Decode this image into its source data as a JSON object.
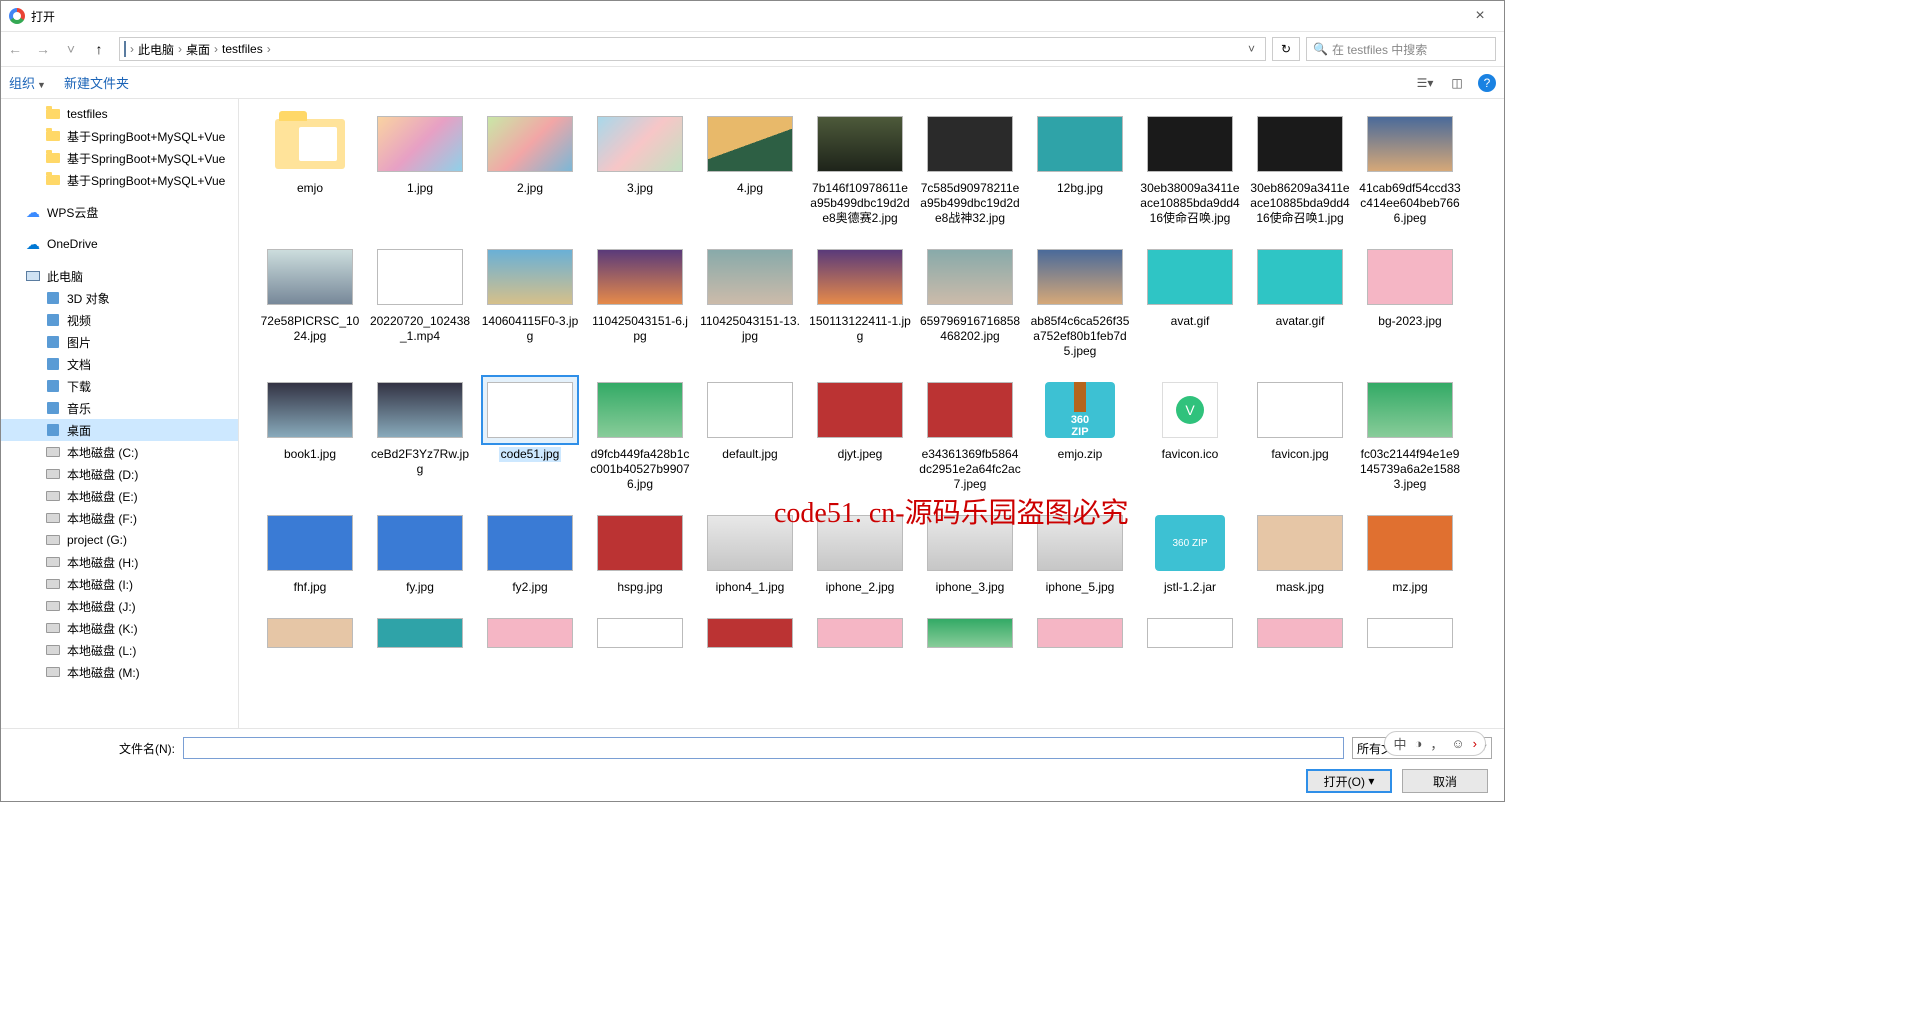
{
  "window": {
    "title": "打开"
  },
  "breadcrumb": {
    "items": [
      "此电脑",
      "桌面",
      "testfiles"
    ],
    "sep": "›"
  },
  "search": {
    "placeholder": "在 testfiles 中搜索"
  },
  "toolbar": {
    "organize": "组织",
    "newfolder": "新建文件夹"
  },
  "watermark": "code51. cn-源码乐园盗图必究",
  "sidebar": [
    {
      "label": "testfiles",
      "icon": "folder",
      "lvl": 1
    },
    {
      "label": "基于SpringBoot+MySQL+Vue",
      "icon": "folder",
      "lvl": 1
    },
    {
      "label": "基于SpringBoot+MySQL+Vue",
      "icon": "folder",
      "lvl": 1
    },
    {
      "label": "基于SpringBoot+MySQL+Vue",
      "icon": "folder",
      "lvl": 1
    },
    {
      "label": "WPS云盘",
      "icon": "wps",
      "lvl": 0,
      "gap": true
    },
    {
      "label": "OneDrive",
      "icon": "onedrive",
      "lvl": 0,
      "gap": true
    },
    {
      "label": "此电脑",
      "icon": "pc",
      "lvl": 0,
      "gap": true
    },
    {
      "label": "3D 对象",
      "icon": "lib",
      "lvl": 1
    },
    {
      "label": "视频",
      "icon": "lib",
      "lvl": 1
    },
    {
      "label": "图片",
      "icon": "lib",
      "lvl": 1
    },
    {
      "label": "文档",
      "icon": "lib",
      "lvl": 1
    },
    {
      "label": "下载",
      "icon": "lib",
      "lvl": 1
    },
    {
      "label": "音乐",
      "icon": "lib",
      "lvl": 1
    },
    {
      "label": "桌面",
      "icon": "lib",
      "lvl": 1,
      "sel": true
    },
    {
      "label": "本地磁盘 (C:)",
      "icon": "drive",
      "lvl": 1
    },
    {
      "label": "本地磁盘 (D:)",
      "icon": "drive",
      "lvl": 1
    },
    {
      "label": "本地磁盘 (E:)",
      "icon": "drive",
      "lvl": 1
    },
    {
      "label": "本地磁盘 (F:)",
      "icon": "drive",
      "lvl": 1
    },
    {
      "label": "project (G:)",
      "icon": "drive",
      "lvl": 1
    },
    {
      "label": "本地磁盘 (H:)",
      "icon": "drive",
      "lvl": 1
    },
    {
      "label": "本地磁盘 (I:)",
      "icon": "drive",
      "lvl": 1
    },
    {
      "label": "本地磁盘 (J:)",
      "icon": "drive",
      "lvl": 1
    },
    {
      "label": "本地磁盘 (K:)",
      "icon": "drive",
      "lvl": 1
    },
    {
      "label": "本地磁盘 (L:)",
      "icon": "drive",
      "lvl": 1
    },
    {
      "label": "本地磁盘 (M:)",
      "icon": "drive",
      "lvl": 1
    }
  ],
  "files": [
    {
      "name": "emjo",
      "type": "folder"
    },
    {
      "name": "1.jpg",
      "type": "img",
      "cls": "g1"
    },
    {
      "name": "2.jpg",
      "type": "img",
      "cls": "g2"
    },
    {
      "name": "3.jpg",
      "type": "img",
      "cls": "g3"
    },
    {
      "name": "4.jpg",
      "type": "img",
      "cls": "g4"
    },
    {
      "name": "7b146f10978611ea95b499dbc19d2de8奥德赛2.jpg",
      "type": "img",
      "cls": "game1"
    },
    {
      "name": "7c585d90978211ea95b499dbc19d2de8战神32.jpg",
      "type": "img",
      "cls": "dark"
    },
    {
      "name": "12bg.jpg",
      "type": "img",
      "cls": "teal"
    },
    {
      "name": "30eb38009a3411eace10885bda9dd416使命召唤.jpg",
      "type": "img",
      "cls": "game2"
    },
    {
      "name": "30eb86209a3411eace10885bda9dd416使命召唤1.jpg",
      "type": "img",
      "cls": "game2"
    },
    {
      "name": "41cab69df54ccd33c414ee604beb7666.jpeg",
      "type": "img",
      "cls": "sky"
    },
    {
      "name": "72e58PICRSC_1024.jpg",
      "type": "img",
      "cls": "city"
    },
    {
      "name": "20220720_102438_1.mp4",
      "type": "img",
      "cls": "anime"
    },
    {
      "name": "140604115F0-3.jpg",
      "type": "img",
      "cls": "beach"
    },
    {
      "name": "110425043151-6.jpg",
      "type": "img",
      "cls": "sunset"
    },
    {
      "name": "110425043151-13.jpg",
      "type": "img",
      "cls": "pano"
    },
    {
      "name": "150113122411-1.jpg",
      "type": "img",
      "cls": "sunset"
    },
    {
      "name": "659796916716858468202.jpg",
      "type": "img",
      "cls": "pano"
    },
    {
      "name": "ab85f4c6ca526f35a752ef80b1feb7d5.jpeg",
      "type": "img",
      "cls": "sky"
    },
    {
      "name": "avat.gif",
      "type": "img",
      "cls": "face-teal"
    },
    {
      "name": "avatar.gif",
      "type": "img",
      "cls": "rabbit"
    },
    {
      "name": "bg-2023.jpg",
      "type": "img",
      "cls": "pink"
    },
    {
      "name": "book1.jpg",
      "type": "img",
      "cls": "mtn"
    },
    {
      "name": "ceBd2F3Yz7Rw.jpg",
      "type": "img",
      "cls": "mtn"
    },
    {
      "name": "code51.jpg",
      "type": "img",
      "cls": "anime",
      "sel": true
    },
    {
      "name": "d9fcb449fa428b1cc001b40527b99076.jpg",
      "type": "img",
      "cls": "green"
    },
    {
      "name": "default.jpg",
      "type": "img",
      "cls": "anime"
    },
    {
      "name": "djyt.jpeg",
      "type": "img",
      "cls": "food"
    },
    {
      "name": "e34361369fb5864dc2951e2a64fc2ac7.jpeg",
      "type": "img",
      "cls": "food"
    },
    {
      "name": "emjo.zip",
      "type": "zip"
    },
    {
      "name": "favicon.ico",
      "type": "ico"
    },
    {
      "name": "favicon.jpg",
      "type": "img",
      "cls": "anime"
    },
    {
      "name": "fc03c2144f94e1e9145739a6a2e15883.jpeg",
      "type": "img",
      "cls": "green"
    },
    {
      "name": "fhf.jpg",
      "type": "img",
      "cls": "blue-scrub"
    },
    {
      "name": "fy.jpg",
      "type": "img",
      "cls": "blue-scrub"
    },
    {
      "name": "fy2.jpg",
      "type": "img",
      "cls": "blue-scrub"
    },
    {
      "name": "hspg.jpg",
      "type": "img",
      "cls": "food"
    },
    {
      "name": "iphon4_1.jpg",
      "type": "img",
      "cls": "phone"
    },
    {
      "name": "iphone_2.jpg",
      "type": "img",
      "cls": "phone"
    },
    {
      "name": "iphone_3.jpg",
      "type": "img",
      "cls": "phone"
    },
    {
      "name": "iphone_5.jpg",
      "type": "img",
      "cls": "phone"
    },
    {
      "name": "jstl-1.2.jar",
      "type": "jar"
    },
    {
      "name": "mask.jpg",
      "type": "img",
      "cls": "photo"
    },
    {
      "name": "mz.jpg",
      "type": "img",
      "cls": "orange"
    }
  ],
  "files_partial": [
    {
      "name": "",
      "type": "img",
      "cls": "photo"
    },
    {
      "name": "",
      "type": "img",
      "cls": "teal"
    },
    {
      "name": "",
      "type": "img",
      "cls": "pink"
    },
    {
      "name": "",
      "type": "img",
      "cls": "anime"
    },
    {
      "name": "",
      "type": "img",
      "cls": "food"
    },
    {
      "name": "",
      "type": "img",
      "cls": "pink"
    },
    {
      "name": "",
      "type": "img",
      "cls": "green"
    },
    {
      "name": "",
      "type": "img",
      "cls": "pink"
    },
    {
      "name": "",
      "type": "img",
      "cls": "anime"
    },
    {
      "name": "",
      "type": "img",
      "cls": "pink"
    },
    {
      "name": "",
      "type": "img",
      "cls": "anime"
    }
  ],
  "footer": {
    "filename_label": "文件名(N):",
    "filename_value": "",
    "filetype": "所有文件 (*.",
    "open": "打开(O)",
    "cancel": "取消"
  },
  "langbar": {
    "zh": "中",
    "moon": "◑",
    "comma": "，",
    "smile": "☺",
    "arrow": "›"
  }
}
